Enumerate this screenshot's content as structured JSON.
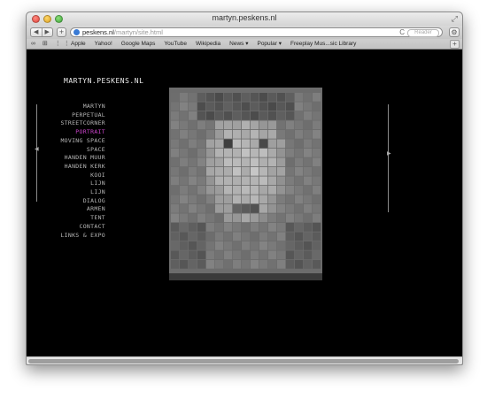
{
  "window": {
    "title": "martyn.peskens.nl"
  },
  "toolbar": {
    "back_icon": "◀",
    "forward_icon": "▶",
    "add_icon": "+",
    "url_host": "peskens.nl",
    "url_path": "/martyn/site.html",
    "reader_label": "Reader",
    "reload_icon": "C",
    "gear_icon": "⚙"
  },
  "bookmarks": {
    "icons": "∞ ⊞ ⋮⋮",
    "items": [
      "Apple",
      "Yahoo!",
      "Google Maps",
      "YouTube",
      "Wikipedia",
      "News ▾",
      "Popular ▾",
      "Freeplay Mus...sic Library"
    ],
    "add_icon": "+"
  },
  "site": {
    "title": "MARTYN.PESKENS.NL",
    "menu": [
      "MARTYN",
      "PERPETUAL",
      "STREETCORNER",
      "PORTRAIT",
      "MOVING SPACE",
      "SPACE",
      "HANDEN MUUR",
      "HANDEN KERK",
      "KOOI",
      "LIJN",
      "LIJN",
      "DIALOG",
      "ARMEN",
      "TENT",
      "CONTACT",
      "LINKS & EXPO"
    ],
    "active_item": "PORTRAIT",
    "active_color": "#cc44cc",
    "left_arrow": "◀",
    "right_arrow": "▶"
  }
}
